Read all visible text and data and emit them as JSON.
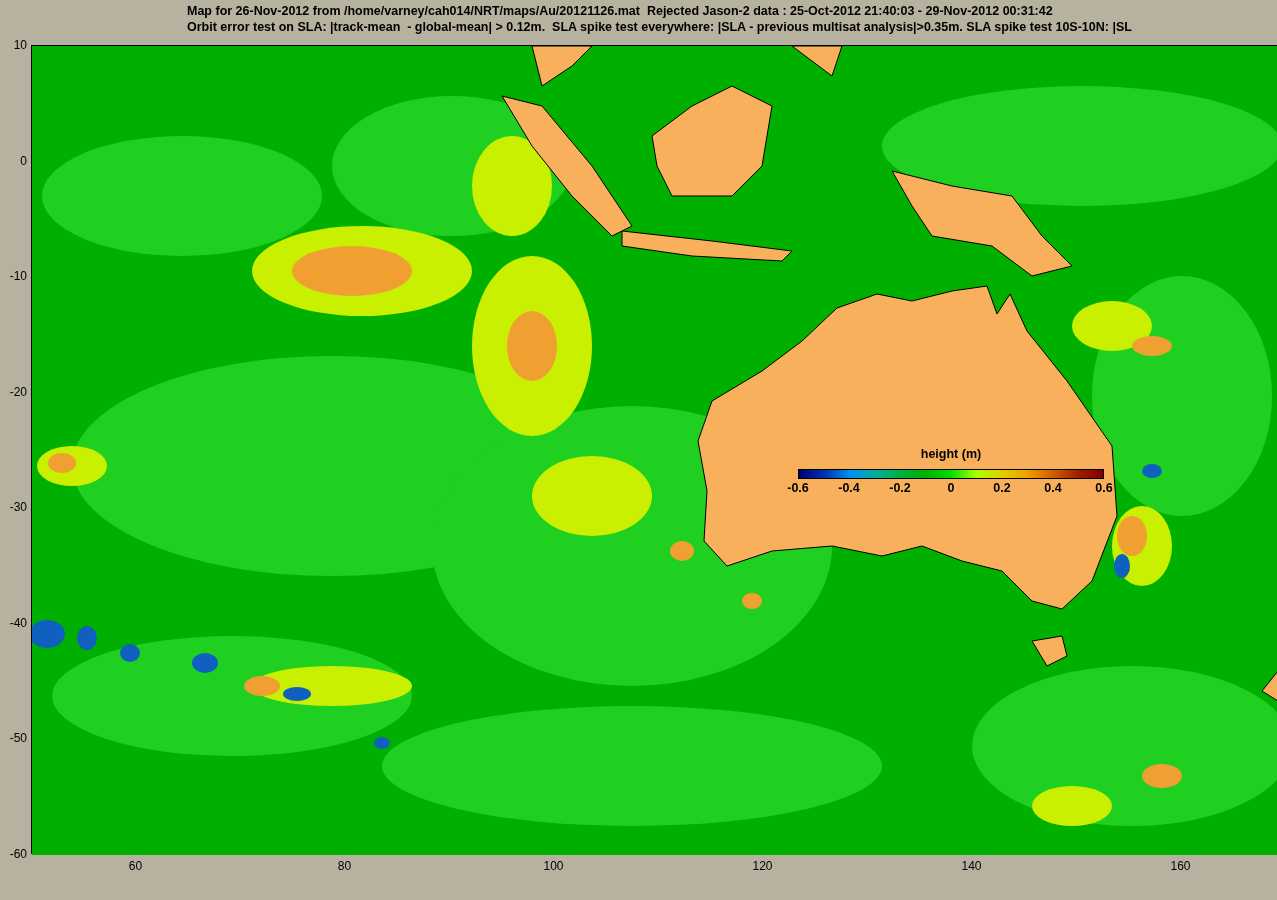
{
  "figure": {
    "title_lines": [
      "Map for 26-Nov-2012 from /home/varney/cah014/NRT/maps/Au/20121126.mat  Rejected Jason-2 data : 25-Oct-2012 21:40:03 - 29-Nov-2012 00:31:42",
      "Orbit error test on SLA: |track-mean  - global-mean| > 0.12m.  SLA spike test everywhere: |SLA - previous multisat analysis|>0.35m. SLA spike test 10S-10N: |SL"
    ]
  },
  "axes": {
    "yticks": [
      "10",
      "0",
      "-10",
      "-20",
      "-30",
      "-40",
      "-50",
      "-60"
    ],
    "xticks": [
      "60",
      "80",
      "100",
      "120",
      "140",
      "160"
    ]
  },
  "colorbar": {
    "label": "height (m)",
    "ticks": [
      "-0.6",
      "-0.4",
      "-0.2",
      "0",
      "0.2",
      "0.4",
      "0.6"
    ]
  }
}
